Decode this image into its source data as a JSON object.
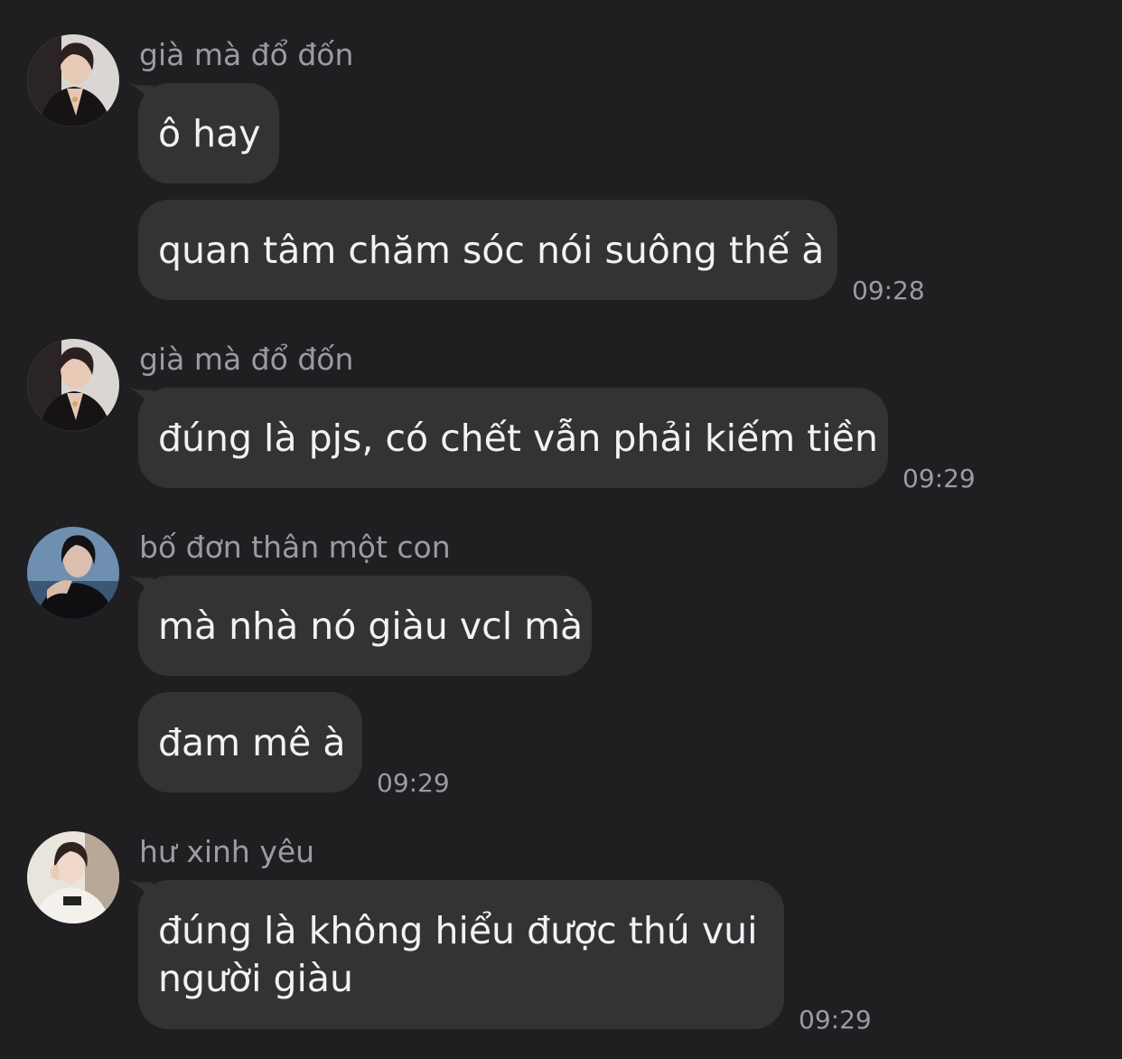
{
  "colors": {
    "background": "#1f1f21",
    "bubble": "#333336",
    "text": "#f2f2f4",
    "meta": "#9b9ba1"
  },
  "groups": [
    {
      "sender": "già mà đổ đốn",
      "avatar_icon": "user-avatar-photo",
      "messages": [
        "ô hay",
        "quan tâm chăm sóc nói suông thế à"
      ],
      "time": "09:28"
    },
    {
      "sender": "già mà đổ đốn",
      "avatar_icon": "user-avatar-photo",
      "messages": [
        "đúng là pjs, có chết vẫn phải kiếm tiền"
      ],
      "time": "09:29"
    },
    {
      "sender": "bố đơn thân một con",
      "avatar_icon": "user-avatar-photo",
      "messages": [
        "mà nhà nó giàu vcl mà",
        "đam mê à"
      ],
      "time": "09:29"
    },
    {
      "sender": "hư xinh yêu",
      "avatar_icon": "user-avatar-photo",
      "messages": [
        "đúng là không hiểu được thú vui người giàu"
      ],
      "time": "09:29"
    }
  ]
}
